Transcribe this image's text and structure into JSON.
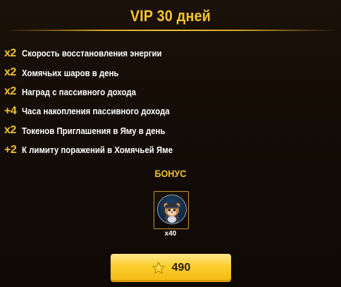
{
  "header": {
    "title": "VIP 30 дней"
  },
  "perks": [
    {
      "mult": "x2",
      "text": "Скорость восстановления энергии"
    },
    {
      "mult": "x2",
      "text": "Хомячьих шаров в день"
    },
    {
      "mult": "x2",
      "text": "Наград с пассивного дохода"
    },
    {
      "mult": "+4",
      "text": "Часа накопления пассивного дохода"
    },
    {
      "mult": "x2",
      "text": "Токенов Приглашения в Яму в день"
    },
    {
      "mult": "+2",
      "text": "К лимиту поражений в Хомячьей Яме"
    }
  ],
  "bonus": {
    "label": "БОНУС",
    "item_icon": "hamster-avatar-icon",
    "quantity": "x40"
  },
  "purchase": {
    "price": "490",
    "currency_icon": "star-icon"
  },
  "colors": {
    "accent": "#f2c12f",
    "background": "#130c06",
    "button": "#f9cd2c"
  }
}
